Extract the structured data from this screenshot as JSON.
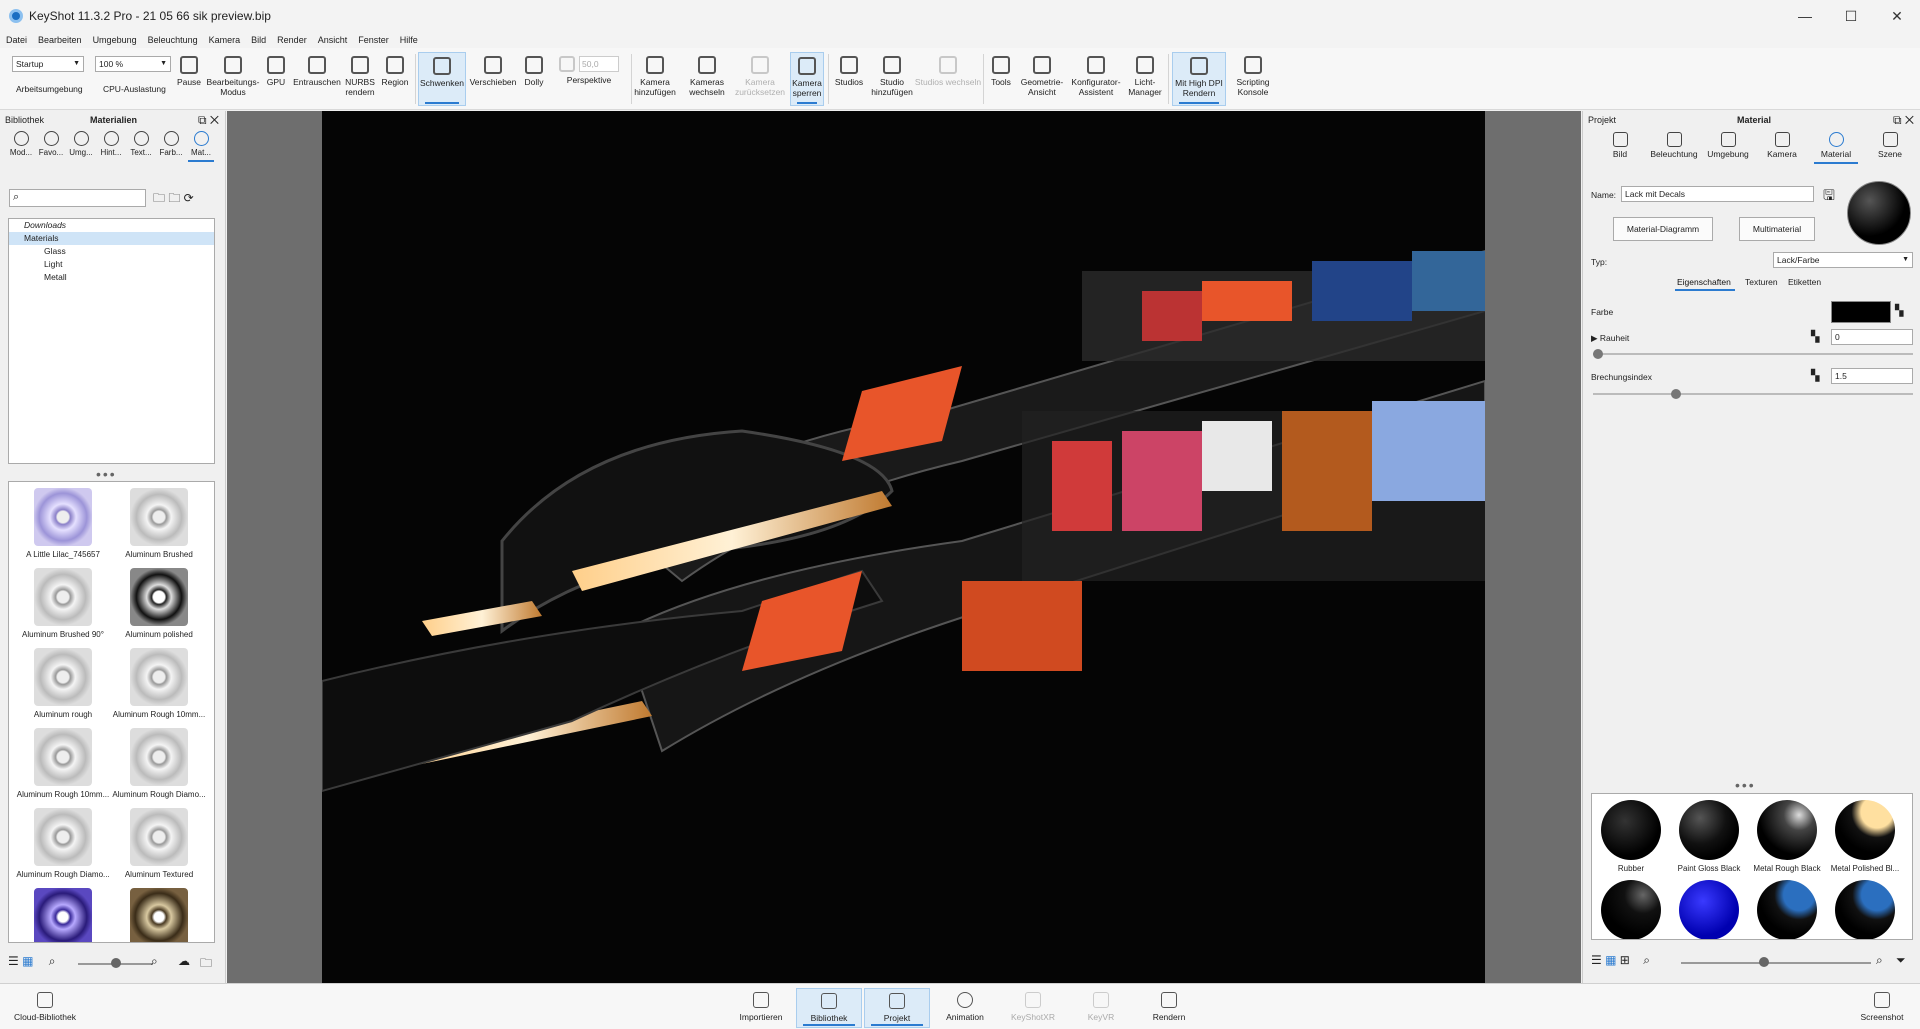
{
  "window": {
    "title": "KeyShot 11.3.2 Pro  - 21 05 66 sik preview.bip"
  },
  "menu": [
    "Datei",
    "Bearbeiten",
    "Umgebung",
    "Beleuchtung",
    "Kamera",
    "Bild",
    "Render",
    "Ansicht",
    "Fenster",
    "Hilfe"
  ],
  "toolbar": {
    "env_select": "Startup",
    "env_label": "Arbeitsumgebung",
    "cpu_select": "100 %",
    "cpu_label": "CPU-Auslastung",
    "buttons": [
      {
        "label": "Pause"
      },
      {
        "label": "Bearbeitungs-\nModus"
      },
      {
        "label": "GPU"
      },
      {
        "label": "Entrauschen"
      },
      {
        "label": "NURBS\nrendern"
      },
      {
        "label": "Region"
      },
      {
        "label": "Schwenken"
      },
      {
        "label": "Verschieben"
      },
      {
        "label": "Dolly"
      },
      {
        "label": "Perspektive"
      },
      {
        "label": "Kamera\nhinzufügen"
      },
      {
        "label": "Kameras\nwechseln"
      },
      {
        "label": "Kamera\nzurücksetzen"
      },
      {
        "label": "Kamera\nsperren"
      },
      {
        "label": "Studios"
      },
      {
        "label": "Studio\nhinzufügen"
      },
      {
        "label": "Studios wechseln"
      },
      {
        "label": "Tools"
      },
      {
        "label": "Geometrie-\nAnsicht"
      },
      {
        "label": "Konfigurator-\nAssistent"
      },
      {
        "label": "Licht-\nManager"
      },
      {
        "label": "Mit High DPI\nRendern"
      },
      {
        "label": "Scripting\nKonsole"
      }
    ],
    "perspective_value": "50,0"
  },
  "left_panel": {
    "header_left": "Bibliothek",
    "header_center": "Materialien",
    "tabs": [
      "Mod...",
      "Favo...",
      "Umg...",
      "Hint...",
      "Text...",
      "Farb...",
      "Mat..."
    ],
    "tree": [
      "Downloads",
      "Materials",
      "Glass",
      "Light",
      "Metall"
    ],
    "thumbs": [
      "A Little Lilac_745657",
      "Aluminum Brushed",
      "Aluminum Brushed 90°",
      "Aluminum polished",
      "Aluminum rough",
      "Aluminum Rough 10mm...",
      "Aluminum Rough 10mm...",
      "Aluminum Rough Diamo...",
      "Aluminum Rough Diamo...",
      "Aluminum Textured"
    ]
  },
  "right_panel": {
    "header_left": "Projekt",
    "header_center": "Material",
    "tabs": [
      "Bild",
      "Beleuchtung",
      "Umgebung",
      "Kamera",
      "Material",
      "Szene"
    ],
    "name_label": "Name:",
    "name_value": "Lack mit Decals",
    "btn_diagram": "Material-Diagramm",
    "btn_multi": "Multimaterial",
    "type_label": "Typ:",
    "type_value": "Lack/Farbe",
    "subtabs": [
      "Eigenschaften",
      "Texturen",
      "Etiketten"
    ],
    "color_label": "Farbe",
    "roughness_label": "Rauheit",
    "roughness_value": "0",
    "ior_label": "Brechungsindex",
    "ior_value": "1.5",
    "materials": [
      "Rubber",
      "Paint Gloss Black",
      "Metal Rough Black",
      "Metal Polished Bl..."
    ]
  },
  "bottom": {
    "cloud": "Cloud-Bibliothek",
    "buttons": [
      "Importieren",
      "Bibliothek",
      "Projekt",
      "Animation",
      "KeyShotXR",
      "KeyVR",
      "Rendern"
    ],
    "screenshot": "Screenshot"
  }
}
